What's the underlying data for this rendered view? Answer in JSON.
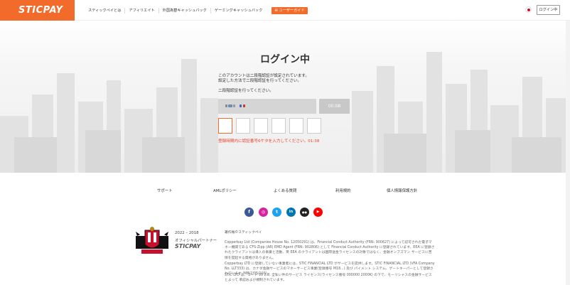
{
  "header": {
    "logo": "STICPAY",
    "nav": [
      "スティックペイとは",
      "アフィリエイト",
      "外国為替キャッシュバック",
      "ゲーミングキャッシュバック"
    ],
    "guide_label": "ユーザーガイド",
    "login_label": "ログイン中",
    "accent": "#f26b2a"
  },
  "main": {
    "title": "ログイン中",
    "line1": "このアカウントは二段階認証が設定されています。",
    "line2": "設定した方法で二段階認証を行ってください。",
    "line3": "二段階認証を行ってください。",
    "timer": "00:08",
    "code_digits": 6,
    "warning": "登録時間内に認証番号6ケタを入力してください。01:38",
    "warning_color": "#e8432e"
  },
  "footer": {
    "links": [
      "サポート",
      "AMLポリシー",
      "よくある質問",
      "利用規約",
      "個人情報保護方針"
    ],
    "social": [
      {
        "icon": "facebook-icon",
        "glyph": "f",
        "color": "#3b5998"
      },
      {
        "icon": "instagram-icon",
        "glyph": "◎",
        "color": "#d6249f"
      },
      {
        "icon": "twitter-icon",
        "glyph": "t",
        "color": "#1da1f2"
      },
      {
        "icon": "linkedin-icon",
        "glyph": "in",
        "color": "#0077b5"
      },
      {
        "icon": "flickr-icon",
        "glyph": "●●",
        "color": "#222222"
      },
      {
        "icon": "youtube-icon",
        "glyph": "▶",
        "color": "#ff0000"
      }
    ],
    "years": "2022 – 2018",
    "partner": "オフィシャルパートナー",
    "brand": "STICPAY",
    "legal_title": "著作権©スティックペイ",
    "legal1": "Copperbay Ltd (Companies House No. 12050291) は、Financial Conduct Authority (FRN: 900627) によって認可された電子マネー機関である CFS-Zipp (AR) EMD Agent (FRN: 902806) として Financial Conduct Authority に登録されています。EEA に登録されたクライアントは導入の事業と活動、英 EEA のクライアントは国際送金ライセンスの対象ではなく、金融オンブズマン サービスに苦情を提起する資格がありません。",
    "legal2": "Copperbay LTD に登録していない事業者には、STIC FINANCIAL LTD がサービスを提供します。STIC FINANCIAL LTD (VFA Company No. LLT333) は、カナダ金融サービスのマネーサービス事業(登録番号 M18...) 及び パイメント システム、ゲートキーパーとして登録されています (MB/2/05/103)。",
    "legal3": "STIC LTD は、コード 10 2.8. 全私い件のサービス ライセンス(ライセンス番号 000000 2000K) の下で、モーリシャスの金融サービスとよって 承認および規制されています。"
  }
}
